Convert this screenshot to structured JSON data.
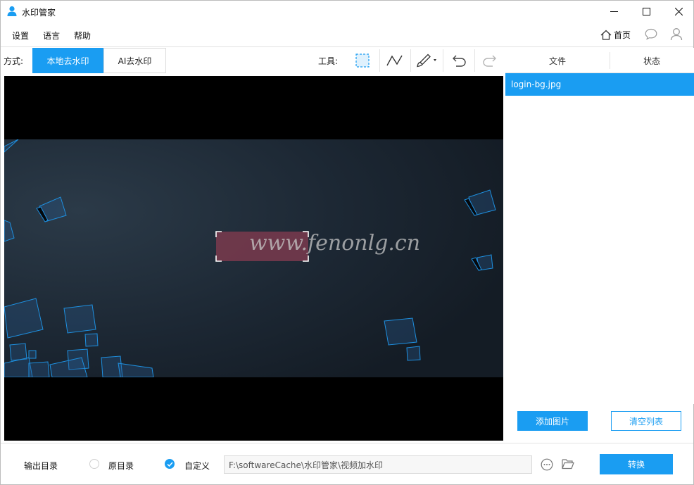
{
  "window": {
    "title": "水印管家",
    "icon": "user-app-icon"
  },
  "menu": {
    "settings": "设置",
    "language": "语言",
    "help": "帮助",
    "home": "首页"
  },
  "toolbar": {
    "mode_label": "方式:",
    "modes": [
      {
        "label": "本地去水印",
        "active": true
      },
      {
        "label": "AI去水印",
        "active": false
      }
    ],
    "tools_label": "工具:",
    "tools": [
      "rect-select-icon",
      "polyline-icon",
      "brush-icon",
      "undo-icon",
      "redo-icon"
    ]
  },
  "file_panel": {
    "col_file": "文件",
    "col_status": "状态",
    "files": [
      {
        "name": "login-bg.jpg",
        "selected": true
      }
    ],
    "add_button": "添加图片",
    "clear_button": "清空列表"
  },
  "canvas": {
    "watermark_text": "www.fenonlg.cn"
  },
  "output": {
    "label": "输出目录",
    "option_original": "原目录",
    "option_custom": "自定义",
    "selected": "custom",
    "path": "F:\\softwareCache\\水印管家\\视频加水印",
    "convert_button": "转换"
  },
  "colors": {
    "accent": "#1a9df2",
    "selection_fill": "#7a3a4e"
  }
}
